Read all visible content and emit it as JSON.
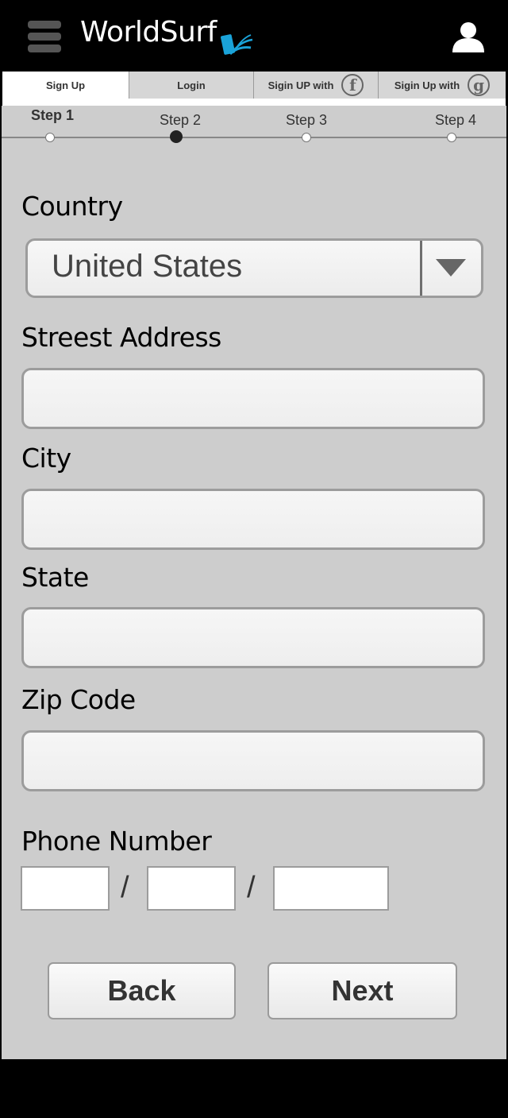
{
  "header": {
    "brand": "WorldSurf",
    "menu_icon": "hamburger-menu-icon",
    "logo_icon": "wave-phone-logo-icon",
    "user_icon": "user-profile-icon"
  },
  "tabs": [
    {
      "label": "Sign Up",
      "active": true
    },
    {
      "label": "Login",
      "active": false
    },
    {
      "label": "Sigin UP with",
      "icon": "f",
      "active": false
    },
    {
      "label": "Sigin Up with",
      "icon": "g",
      "active": false
    }
  ],
  "steps": [
    {
      "label": "Step 1",
      "current": true
    },
    {
      "label": "Step 2",
      "current": false
    },
    {
      "label": "Step 3",
      "current": false
    },
    {
      "label": "Step 4",
      "current": false
    }
  ],
  "form": {
    "country_label": "Country",
    "country_value": "United States",
    "street_label": "Streest Address",
    "city_label": "City",
    "state_label": "State",
    "zip_label": "Zip Code",
    "phone_label": "Phone Number",
    "phone_separator": "/"
  },
  "buttons": {
    "back": "Back",
    "next": "Next"
  },
  "colors": {
    "header_bg": "#000000",
    "form_bg": "#cdcdcd",
    "logo_accent": "#1aa3d9"
  }
}
